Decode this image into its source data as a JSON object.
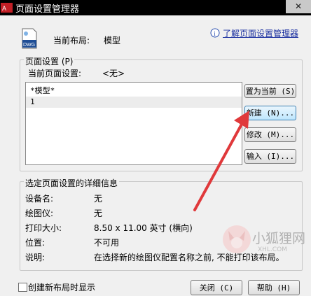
{
  "window": {
    "title": "页面设置管理器",
    "close_label": "✕"
  },
  "header": {
    "current_layout_label": "当前布局:",
    "current_layout_value": "模型",
    "help_link": "了解页面设置管理器",
    "doc_icon_text": "DWG"
  },
  "page_setup": {
    "group_title": "页面设置 (P)",
    "current_label": "当前页面设置:",
    "current_value": "<无>",
    "items": [
      "*模型*",
      "1"
    ]
  },
  "buttons": {
    "set_current": "置为当前 (S)",
    "new": "新建 (N)...",
    "modify": "修改 (M)...",
    "import": "输入 (I)...",
    "close": "关闭 (C)",
    "help": "帮助 (H)"
  },
  "details": {
    "group_title": "选定页面设置的详细信息",
    "rows": [
      {
        "label": "设备名:",
        "value": "无"
      },
      {
        "label": "绘图仪:",
        "value": "无"
      },
      {
        "label": "打印大小:",
        "value": "8.50 x 11.00 英寸 (横向)"
      },
      {
        "label": "位置:",
        "value": "不可用"
      },
      {
        "label": "说明:",
        "value": "在选择新的绘图仪配置名称之前, 不能打印该布局。"
      }
    ]
  },
  "footer": {
    "checkbox_label": "创建新布局时显示",
    "checkbox_checked": false
  },
  "watermark": {
    "text": "小狐狸网",
    "sub_text": "XHL.COM"
  },
  "colors": {
    "link": "#1a2fa0",
    "arrow": "#e0393b",
    "titlebar": "#000000"
  }
}
